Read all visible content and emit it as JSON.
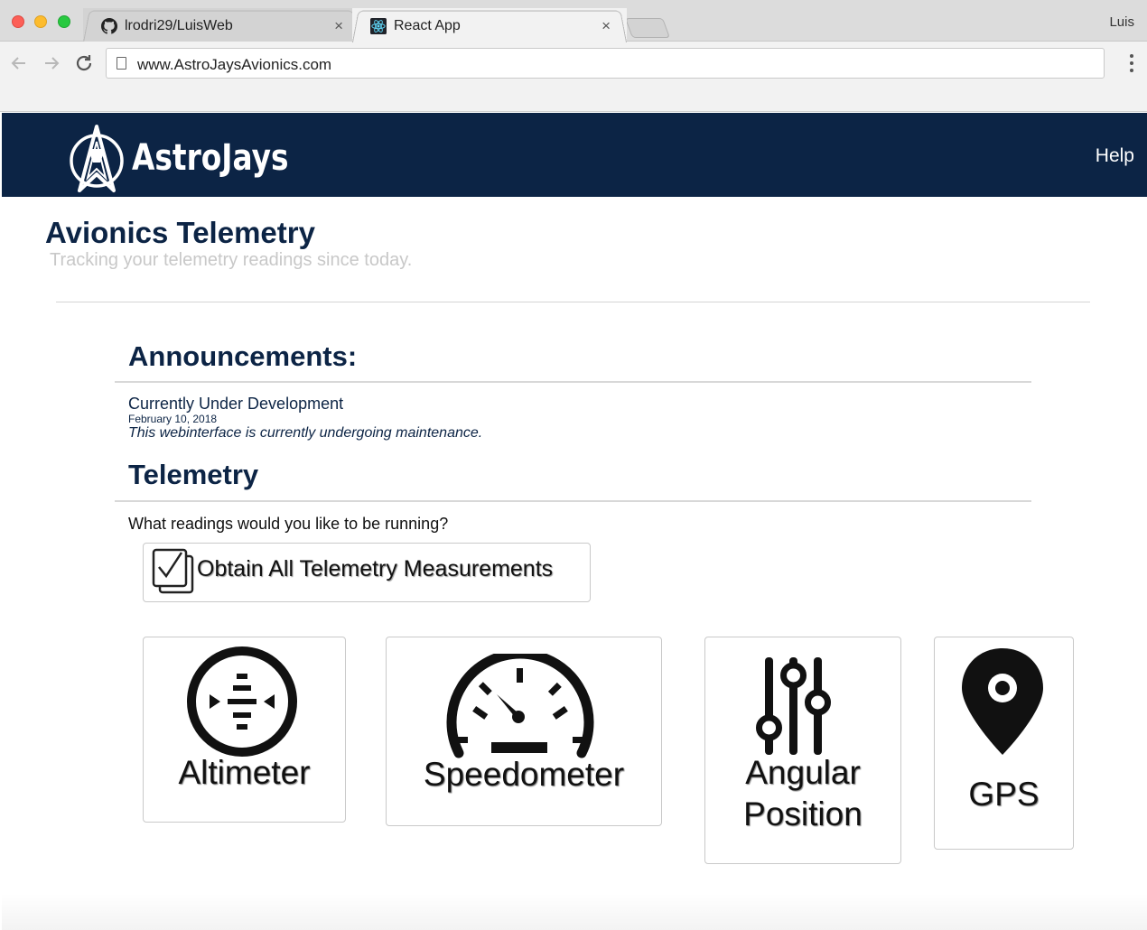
{
  "browser": {
    "tabs": [
      {
        "label": "lrodri29/LuisWeb",
        "icon": "github-icon",
        "active": false
      },
      {
        "label": "React App",
        "icon": "react-icon",
        "active": true
      }
    ],
    "close_glyph": "×",
    "profile_name": "Luis",
    "url": "www.AstroJaysAvionics.com"
  },
  "navbar": {
    "brand": "AstroJays",
    "help_label": "Help",
    "color": "#0c2445"
  },
  "header": {
    "title": "Avionics Telemetry",
    "subtitle": "Tracking your telemetry readings since today."
  },
  "announcements": {
    "heading": "Announcements:",
    "items": [
      {
        "title": "Currently Under Development",
        "date": "February 10, 2018",
        "body": "This webinterface is currently undergoing maintenance."
      }
    ]
  },
  "telemetry": {
    "heading": "Telemetry",
    "prompt": "What readings would you like to be running?",
    "obtain_all_label": "Obtain All Telemetry Measurements",
    "tiles": [
      {
        "label": "Altimeter",
        "icon": "altimeter-icon"
      },
      {
        "label": "Speedometer",
        "icon": "speedometer-icon"
      },
      {
        "label_line1": "Angular",
        "label_line2": "Position",
        "icon": "sliders-icon"
      },
      {
        "label": "GPS",
        "icon": "map-pin-icon"
      }
    ]
  }
}
